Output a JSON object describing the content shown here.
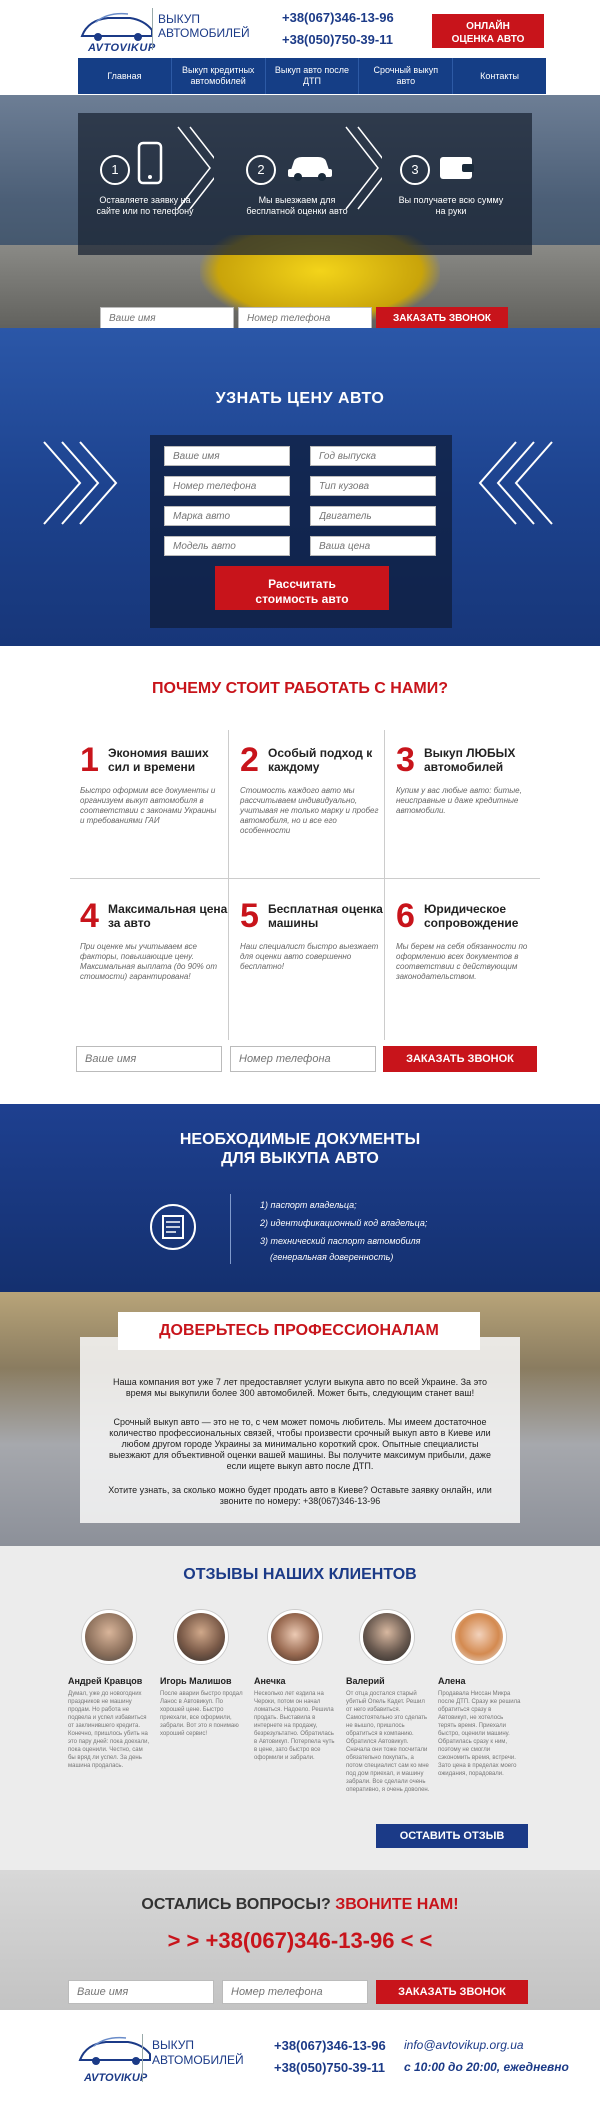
{
  "header": {
    "logo_text": "AVTOVIKUP",
    "logo_sub_1": "ВЫКУП",
    "logo_sub_2": "АВТОМОБИЛЕЙ",
    "phone_1": "+38(067)346-13-96",
    "phone_2": "+38(050)750-39-11",
    "cta_line_1": "ОНЛАЙН",
    "cta_line_2": "ОЦЕНКА АВТО"
  },
  "nav": {
    "items": [
      {
        "label": "Главная"
      },
      {
        "label": "Выкуп кредитных автомобилей"
      },
      {
        "label": "Выкуп авто после ДТП"
      },
      {
        "label": "Срочный выкуп авто"
      },
      {
        "label": "Контакты"
      }
    ]
  },
  "hero": {
    "steps": [
      {
        "num": "1",
        "text": "Оставляете заявку на сайте или по телефону"
      },
      {
        "num": "2",
        "text": "Мы выезжаем для бесплатной оценки авто"
      },
      {
        "num": "3",
        "text": "Вы получаете всю сумму на руки"
      }
    ],
    "name_placeholder": "Ваше имя",
    "phone_placeholder": "Номер телефона",
    "button": "ЗАКАЗАТЬ ЗВОНОК"
  },
  "price": {
    "title": "УЗНАТЬ ЦЕНУ АВТО",
    "fields": {
      "name": "Ваше имя",
      "year": "Год выпуска",
      "phone": "Номер телефона",
      "body": "Тип кузова",
      "brand": "Марка авто",
      "engine": "Двигатель",
      "model": "Модель авто",
      "wish": "Ваша цена"
    },
    "button_1": "Рассчитать",
    "button_2": "стоимость авто"
  },
  "why": {
    "title": "ПОЧЕМУ СТОИТ РАБОТАТЬ С НАМИ?",
    "cards": [
      {
        "num": "1",
        "title": "Экономия ваших сил и времени",
        "desc": "Быстро оформим все документы и организуем выкуп автомобиля в соответствии с законами Украины и требованиями ГАИ"
      },
      {
        "num": "2",
        "title": "Особый подход к каждому",
        "desc": "Стоимость каждого авто мы рассчитываем индивидуально, учитывая не только марку и пробег автомобиля, но и все его особенности"
      },
      {
        "num": "3",
        "title": "Выкуп ЛЮБЫХ автомобилей",
        "desc": "Купим у вас любые авто: битые, неисправные и даже кредитные автомобили."
      },
      {
        "num": "4",
        "title": "Максимальная цена за авто",
        "desc": "При оценке мы учитываем все факторы, повышающие цену. Максимальная выплата (до 90% от стоимости) гарантирована!"
      },
      {
        "num": "5",
        "title": "Бесплатная оценка машины",
        "desc": "Наш специалист быстро выезжает для оценки авто совершенно бесплатно!"
      },
      {
        "num": "6",
        "title": "Юридическое сопровождение",
        "desc": "Мы берем на себя обязанности по оформлению всех документов в соответствии с действующим законодательством."
      }
    ],
    "name_placeholder": "Ваше имя",
    "phone_placeholder": "Номер телефона",
    "button": "ЗАКАЗАТЬ ЗВОНОК"
  },
  "docs": {
    "title_1": "НЕОБХОДИМЫЕ ДОКУМЕНТЫ",
    "title_2": "ДЛЯ ВЫКУПА АВТО",
    "items": [
      "1) паспорт владельца;",
      "2) идентификационный код владельца;",
      "3) технический паспорт автомобиля",
      "(генеральная доверенность)"
    ]
  },
  "trust": {
    "title": "ДОВЕРЬТЕСЬ ПРОФЕССИОНАЛАМ",
    "p1": "Наша компания вот уже 7 лет предоставляет услуги выкупа авто по всей Украине. За это время мы выкупили более 300 автомобилей. Может быть, следующим станет ваш!",
    "p2": "Срочный выкуп авто — это не то, с чем может помочь любитель. Мы имеем достаточное количество профессиональных связей, чтобы произвести срочный выкуп авто в Киеве или любом другом городе Украины за минимально короткий срок. Опытные специалисты выезжают для объективной оценки вашей машины. Вы получите максимум прибыли, даже если ищете выкуп авто после ДТП.",
    "p3": "Хотите узнать, за сколько можно будет продать авто в Киеве? Оставьте заявку онлайн, или звоните по номеру: +38(067)346-13-96"
  },
  "reviews": {
    "title": "ОТЗЫВЫ НАШИХ КЛИЕНТОВ",
    "items": [
      {
        "name": "Андрей Кравцов",
        "text": "Думал, уже до новогодних праздников не машину продам. Но работа не подвела и успел избавиться от заклинившего кредита. Конечно, пришлось убить на это пару дней: пока доехали, пока оценили. Честно, сам бы вряд ли успел. За день машина продалась."
      },
      {
        "name": "Игорь Малишов",
        "text": "После аварии быстро продал Ланос в Автовикуп. По хорошей цене. Быстро приехали, все оформили, забрали. Вот это я понимаю хороший сервис!"
      },
      {
        "name": "Анечка",
        "text": "Несколько лет ездила на Чероки, потом он начал ломаться. Надоело. Решила продать. Выставила в интернете на продажу, безрезультатно. Обратилась в Автовикуп. Потерпела чуть в цене, зато быстро все оформили и забрали."
      },
      {
        "name": "Валерий",
        "text": "От отца достался старый убитый Опель Кадет. Решил от него избавиться. Самостоятельно это сделать не вышло, пришлось обратиться в компанию. Обратился Автовикуп. Сначала они тоже посчитали обязательно покупать, а потом специалист сам ко мне под дом приехал, и машину забрали. Все сделали очень оперативно, я очень доволен."
      },
      {
        "name": "Алена",
        "text": "Продавала Ниссан Микра после ДТП. Сразу же решила обратиться сразу в Автовикуп, не хотелось терять время. Приехали быстро, оценили машину. Обратилась сразу к ним, поэтому не смогли сэкономить время, встречи. Зато цена в пределах моего ожидания, порадовали."
      }
    ],
    "button": "ОСТАВИТЬ ОТЗЫВ"
  },
  "questions": {
    "title_1": "ОСТАЛИСЬ ВОПРОСЫ?",
    "title_2": "ЗВОНИТЕ НАМ!",
    "big_phone": "> >  +38(067)346-13-96  < <",
    "name_placeholder": "Ваше имя",
    "phone_placeholder": "Номер телефона",
    "button": "ЗАКАЗАТЬ ЗВОНОК"
  },
  "footer": {
    "logo_text": "AVTOVIKUP",
    "logo_sub_1": "ВЫКУП",
    "logo_sub_2": "АВТОМОБИЛЕЙ",
    "phone_1": "+38(067)346-13-96",
    "phone_2": "+38(050)750-39-11",
    "email": "info@avtovikup.org.ua",
    "hours": "с 10:00 до 20:00, ежедневно"
  }
}
